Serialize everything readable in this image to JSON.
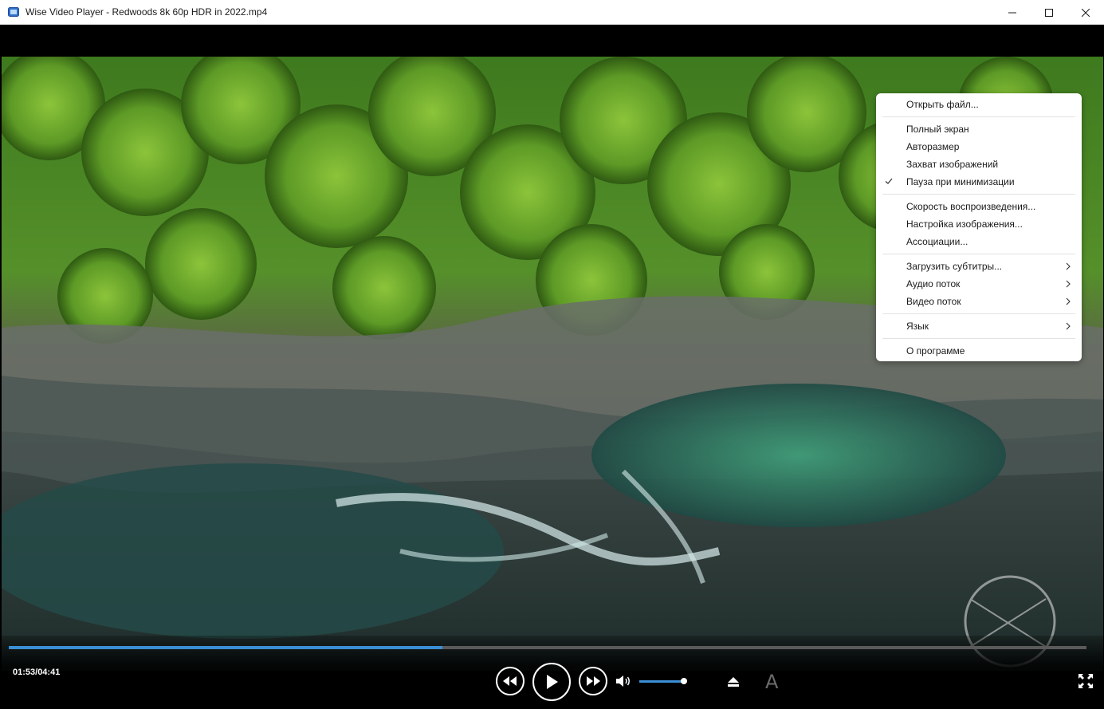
{
  "window": {
    "title": "Wise Video Player - Redwoods 8k 60p HDR in 2022.mp4"
  },
  "context_menu": {
    "items": [
      {
        "label": "Открыть файл..."
      },
      {
        "label": "Полный экран"
      },
      {
        "label": "Авторазмер"
      },
      {
        "label": "Захват изображений"
      },
      {
        "label": "Пауза при минимизации",
        "checked": true
      },
      {
        "label": "Скорость воспроизведения..."
      },
      {
        "label": "Настройка изображения..."
      },
      {
        "label": "Ассоциации..."
      },
      {
        "label": "Загрузить субтитры...",
        "submenu": true
      },
      {
        "label": "Аудио поток",
        "submenu": true
      },
      {
        "label": "Видео поток",
        "submenu": true
      },
      {
        "label": "Язык",
        "submenu": true
      },
      {
        "label": "О программе"
      }
    ]
  },
  "player": {
    "time": "01:53/04:41",
    "progress_fraction": 0.402,
    "volume_fraction": 1.0,
    "subtitle_button_glyph": "A",
    "accent_color": "#3a8fd6"
  },
  "icons": {
    "rewind": "rewind-icon",
    "play": "play-icon",
    "forward": "fast-forward-icon",
    "volume": "speaker-icon",
    "eject": "eject-icon",
    "subtitle": "subtitle-icon",
    "fullscreen": "fullscreen-icon"
  }
}
